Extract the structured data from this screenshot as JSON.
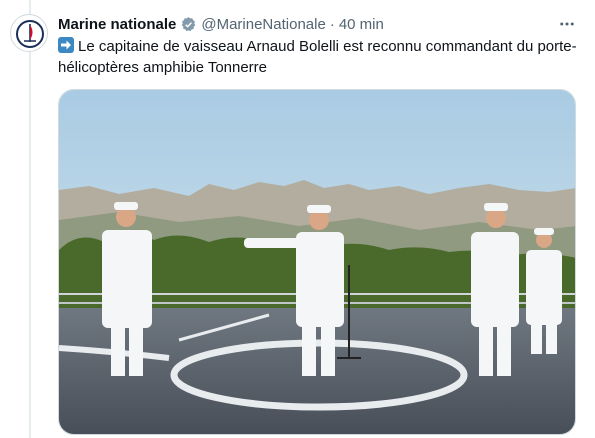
{
  "tweet": {
    "author_name": "Marine nationale",
    "handle": "@MarineNationale",
    "separator": "·",
    "timestamp": "40 min",
    "text_emoji": "right-arrow-emoji",
    "text": "Le capitaine de vaisseau Arnaud Bolelli est reconnu commandant du porte-hélicoptères amphibie Tonnerre",
    "verified_badge": "verified-badge-icon",
    "more_icon": "more-options-icon"
  },
  "colors": {
    "accent": "#1d9bf0",
    "secondary_text": "#536471",
    "verified_grey": "#829aab",
    "emoji_blue": "#3b88c3"
  },
  "media": {
    "type": "photo",
    "subject": "ceremony on ship flight deck"
  }
}
